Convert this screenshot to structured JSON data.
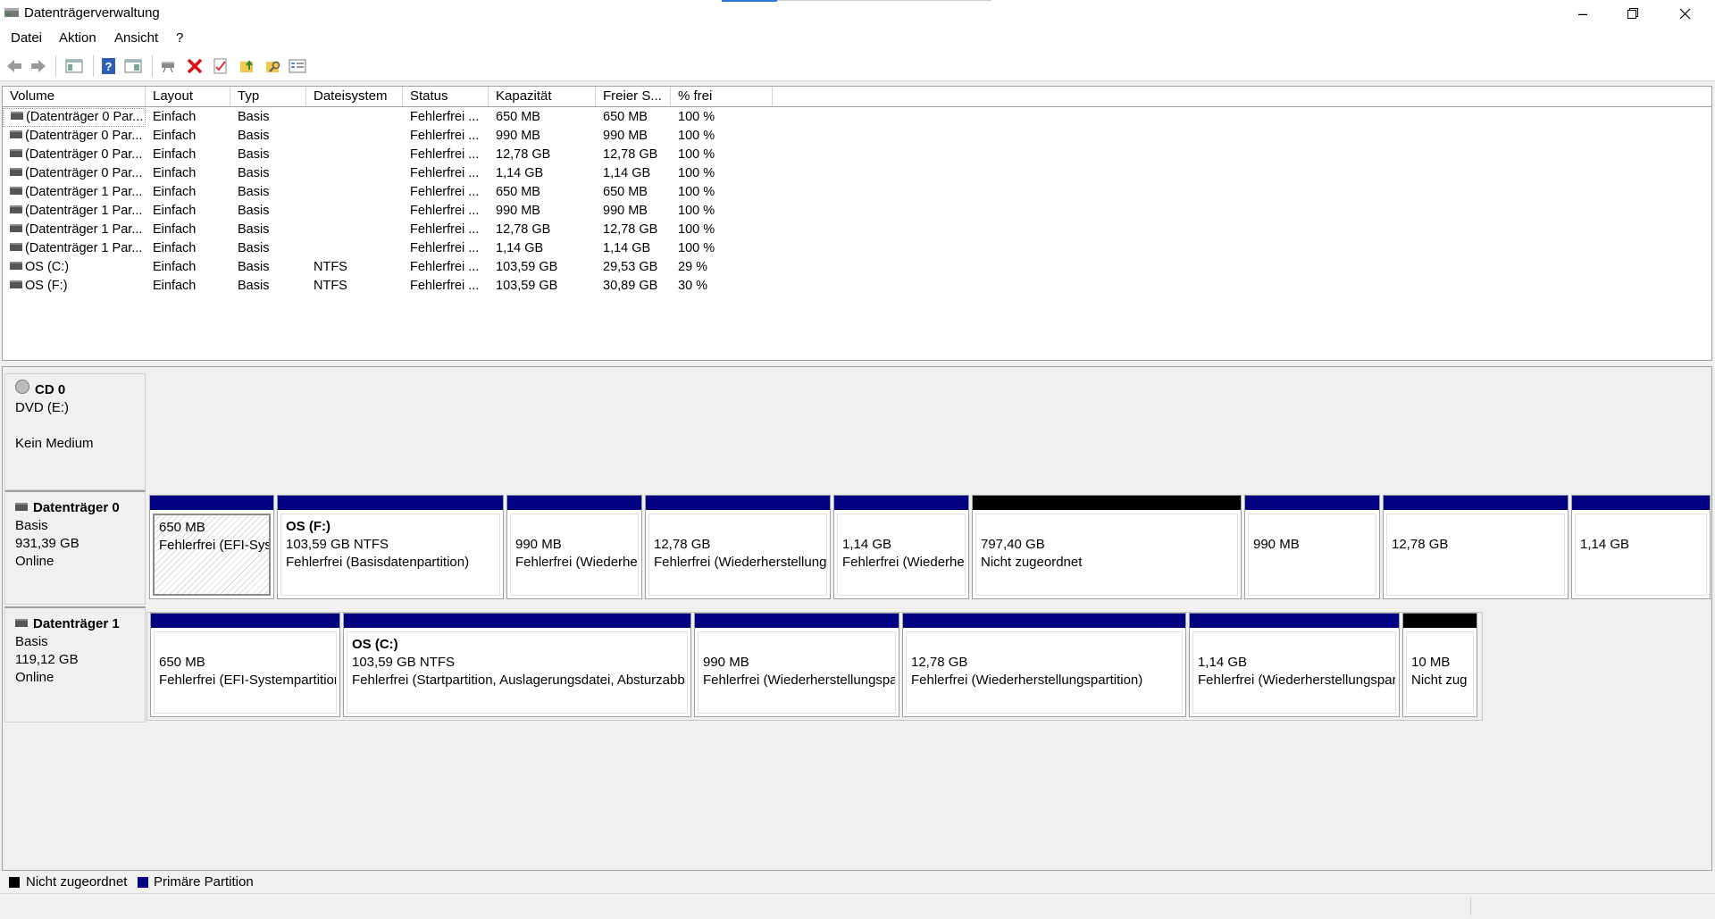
{
  "window": {
    "title": "Datenträgerverwaltung"
  },
  "menu": [
    "Datei",
    "Aktion",
    "Ansicht",
    "?"
  ],
  "colors": {
    "primary_partition": "#000080",
    "unallocated": "#000000"
  },
  "volumes": {
    "columns": [
      "Volume",
      "Layout",
      "Typ",
      "Dateisystem",
      "Status",
      "Kapazität",
      "Freier S...",
      "% frei"
    ],
    "rows": [
      [
        "(Datenträger 0 Par...",
        "Einfach",
        "Basis",
        "",
        "Fehlerfrei ...",
        "650 MB",
        "650 MB",
        "100 %"
      ],
      [
        "(Datenträger 0 Par...",
        "Einfach",
        "Basis",
        "",
        "Fehlerfrei ...",
        "990 MB",
        "990 MB",
        "100 %"
      ],
      [
        "(Datenträger 0 Par...",
        "Einfach",
        "Basis",
        "",
        "Fehlerfrei ...",
        "12,78 GB",
        "12,78 GB",
        "100 %"
      ],
      [
        "(Datenträger 0 Par...",
        "Einfach",
        "Basis",
        "",
        "Fehlerfrei ...",
        "1,14 GB",
        "1,14 GB",
        "100 %"
      ],
      [
        "(Datenträger 1 Par...",
        "Einfach",
        "Basis",
        "",
        "Fehlerfrei ...",
        "650 MB",
        "650 MB",
        "100 %"
      ],
      [
        "(Datenträger 1 Par...",
        "Einfach",
        "Basis",
        "",
        "Fehlerfrei ...",
        "990 MB",
        "990 MB",
        "100 %"
      ],
      [
        "(Datenträger 1 Par...",
        "Einfach",
        "Basis",
        "",
        "Fehlerfrei ...",
        "12,78 GB",
        "12,78 GB",
        "100 %"
      ],
      [
        "(Datenträger 1 Par...",
        "Einfach",
        "Basis",
        "",
        "Fehlerfrei ...",
        "1,14 GB",
        "1,14 GB",
        "100 %"
      ],
      [
        "OS (C:)",
        "Einfach",
        "Basis",
        "NTFS",
        "Fehlerfrei ...",
        "103,59 GB",
        "29,53 GB",
        "29 %"
      ],
      [
        "OS (F:)",
        "Einfach",
        "Basis",
        "NTFS",
        "Fehlerfrei ...",
        "103,59 GB",
        "30,89 GB",
        "30 %"
      ]
    ]
  },
  "cd0": {
    "name": "CD 0",
    "line1": "DVD (E:)",
    "line2": "Kein Medium"
  },
  "disk0": {
    "name": "Datenträger 0",
    "type": "Basis",
    "size": "931,39 GB",
    "state": "Online",
    "partitions": [
      {
        "title": "",
        "size": "650 MB",
        "status": "Fehlerfrei (EFI-Syst",
        "kind": "primary"
      },
      {
        "title": "OS  (F:)",
        "size": "103,59 GB NTFS",
        "status": "Fehlerfrei (Basisdatenpartition)",
        "kind": "primary"
      },
      {
        "title": "",
        "size": "990 MB",
        "status": "Fehlerfrei (Wiederhe",
        "kind": "primary"
      },
      {
        "title": "",
        "size": "12,78 GB",
        "status": "Fehlerfrei (Wiederherstellung",
        "kind": "primary"
      },
      {
        "title": "",
        "size": "1,14 GB",
        "status": "Fehlerfrei (Wiederhe",
        "kind": "primary"
      },
      {
        "title": "",
        "size": "797,40 GB",
        "status": "Nicht zugeordnet",
        "kind": "unallocated"
      },
      {
        "title": "",
        "size": "990 MB",
        "status": "",
        "kind": "primary"
      },
      {
        "title": "",
        "size": "12,78 GB",
        "status": "",
        "kind": "primary"
      },
      {
        "title": "",
        "size": "1,14 GB",
        "status": "",
        "kind": "primary"
      }
    ]
  },
  "disk1": {
    "name": "Datenträger 1",
    "type": "Basis",
    "size": "119,12 GB",
    "state": "Online",
    "partitions": [
      {
        "title": "",
        "size": "650 MB",
        "status": "Fehlerfrei (EFI-Systempartition",
        "kind": "primary"
      },
      {
        "title": "OS  (C:)",
        "size": "103,59 GB NTFS",
        "status": "Fehlerfrei (Startpartition, Auslagerungsdatei, Absturzabb",
        "kind": "primary"
      },
      {
        "title": "",
        "size": "990 MB",
        "status": "Fehlerfrei (Wiederherstellungspa",
        "kind": "primary"
      },
      {
        "title": "",
        "size": "12,78 GB",
        "status": "Fehlerfrei (Wiederherstellungspartition)",
        "kind": "primary"
      },
      {
        "title": "",
        "size": "1,14 GB",
        "status": "Fehlerfrei (Wiederherstellungspar",
        "kind": "primary"
      },
      {
        "title": "",
        "size": "10 MB",
        "status": "Nicht zug",
        "kind": "unallocated"
      }
    ]
  },
  "legend": {
    "unallocated": "Nicht zugeordnet",
    "primary": "Primäre Partition"
  }
}
